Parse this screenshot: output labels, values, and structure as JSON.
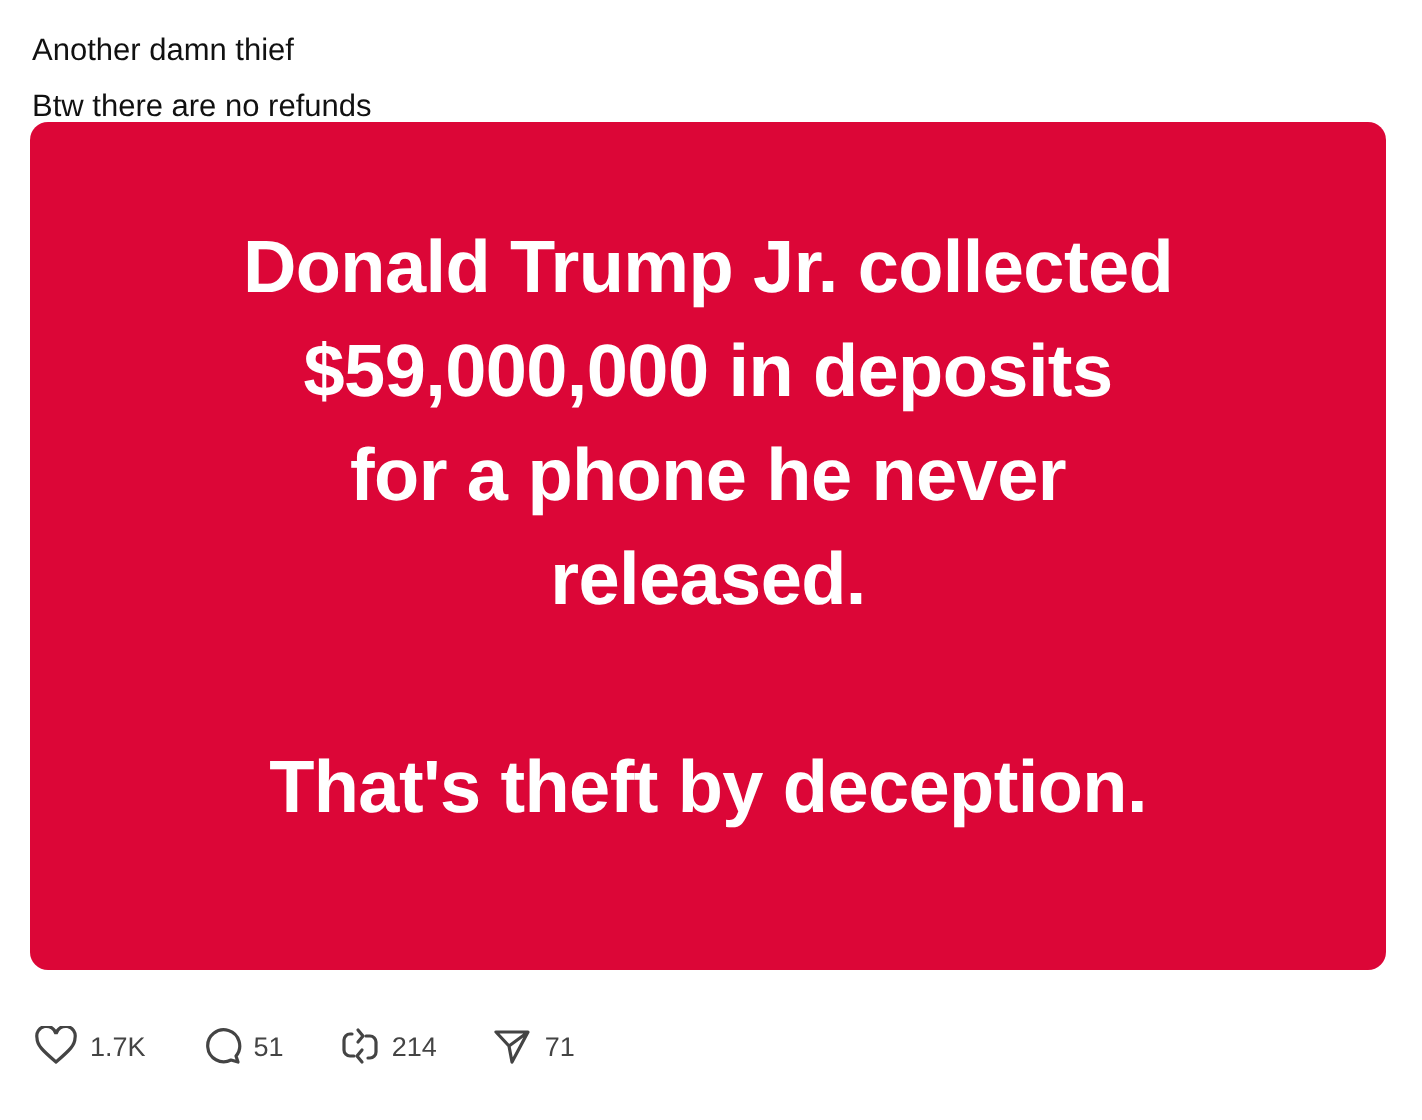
{
  "post": {
    "text_lines": [
      "Another damn thief",
      "Btw there are no refunds"
    ],
    "image": {
      "paragraphs": [
        [
          "Donald Trump Jr. collected",
          "$59,000,000 in deposits",
          "for a phone he never",
          "released."
        ],
        [
          "That's theft by deception."
        ]
      ]
    },
    "actions": [
      {
        "kind": "like",
        "count": "1.7K"
      },
      {
        "kind": "reply",
        "count": "51"
      },
      {
        "kind": "repost",
        "count": "214"
      },
      {
        "kind": "share",
        "count": "71"
      }
    ]
  }
}
